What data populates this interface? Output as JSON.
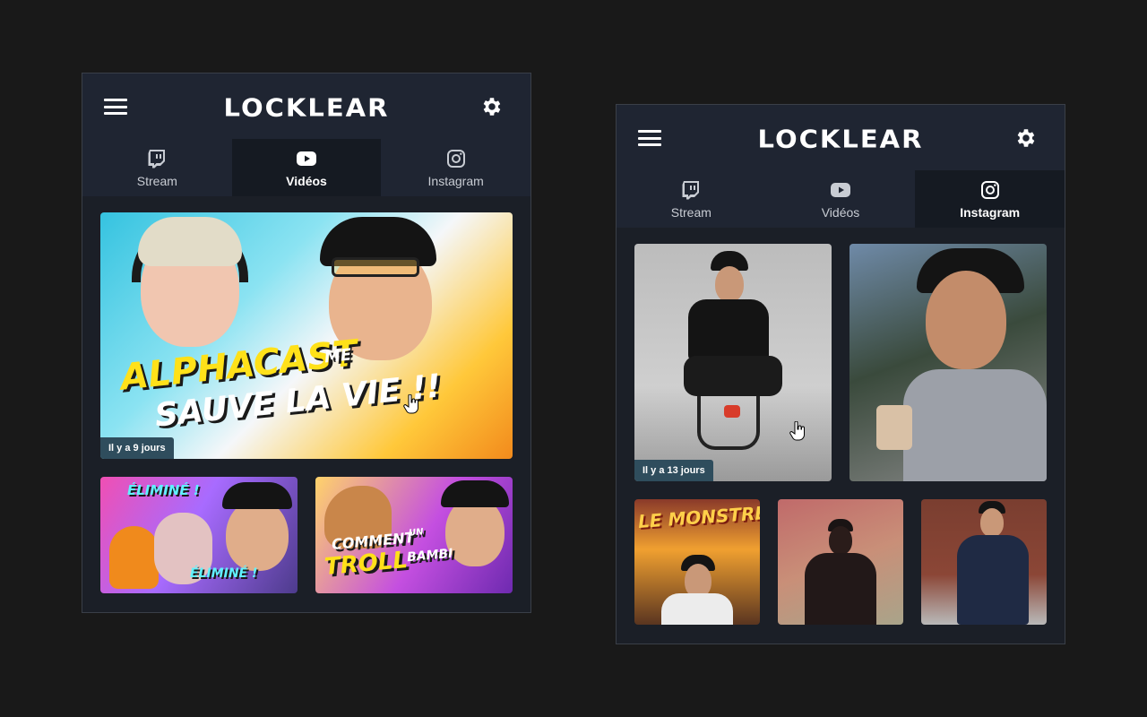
{
  "brand": {
    "logo_text": "LOCKLEAR"
  },
  "colors": {
    "background": "#191919",
    "panel": "#1b1f27",
    "header": "#1f2532",
    "active_tab": "#151a22",
    "badge": "#2f4d5d"
  },
  "icons": {
    "menu": "hamburger-icon",
    "settings": "gear-icon",
    "stream": "twitch-icon",
    "videos": "youtube-icon",
    "instagram": "instagram-icon"
  },
  "panel_videos": {
    "tabs": [
      {
        "label": "Stream",
        "active": false
      },
      {
        "label": "Vidéos",
        "active": true
      },
      {
        "label": "Instagram",
        "active": false
      }
    ],
    "featured": {
      "title_line1": "ALPHACAST",
      "title_me": "ME",
      "title_line2": "SAUVE LA VIE !!",
      "age": "Il y a 9 jours"
    },
    "videos": [
      {
        "title_top": "ÉLIMINÉ !",
        "title_bottom": "ÉLIMINÉ !"
      },
      {
        "title_line1": "COMMENT",
        "title_un": "UN",
        "title_line2": "TROLL",
        "title_bambi": "BAMBI"
      }
    ]
  },
  "panel_instagram": {
    "tabs": [
      {
        "label": "Stream",
        "active": false
      },
      {
        "label": "Vidéos",
        "active": false
      },
      {
        "label": "Instagram",
        "active": true
      }
    ],
    "featured_age": "Il y a 13 jours",
    "sign_text": "LE MONSTRE"
  }
}
